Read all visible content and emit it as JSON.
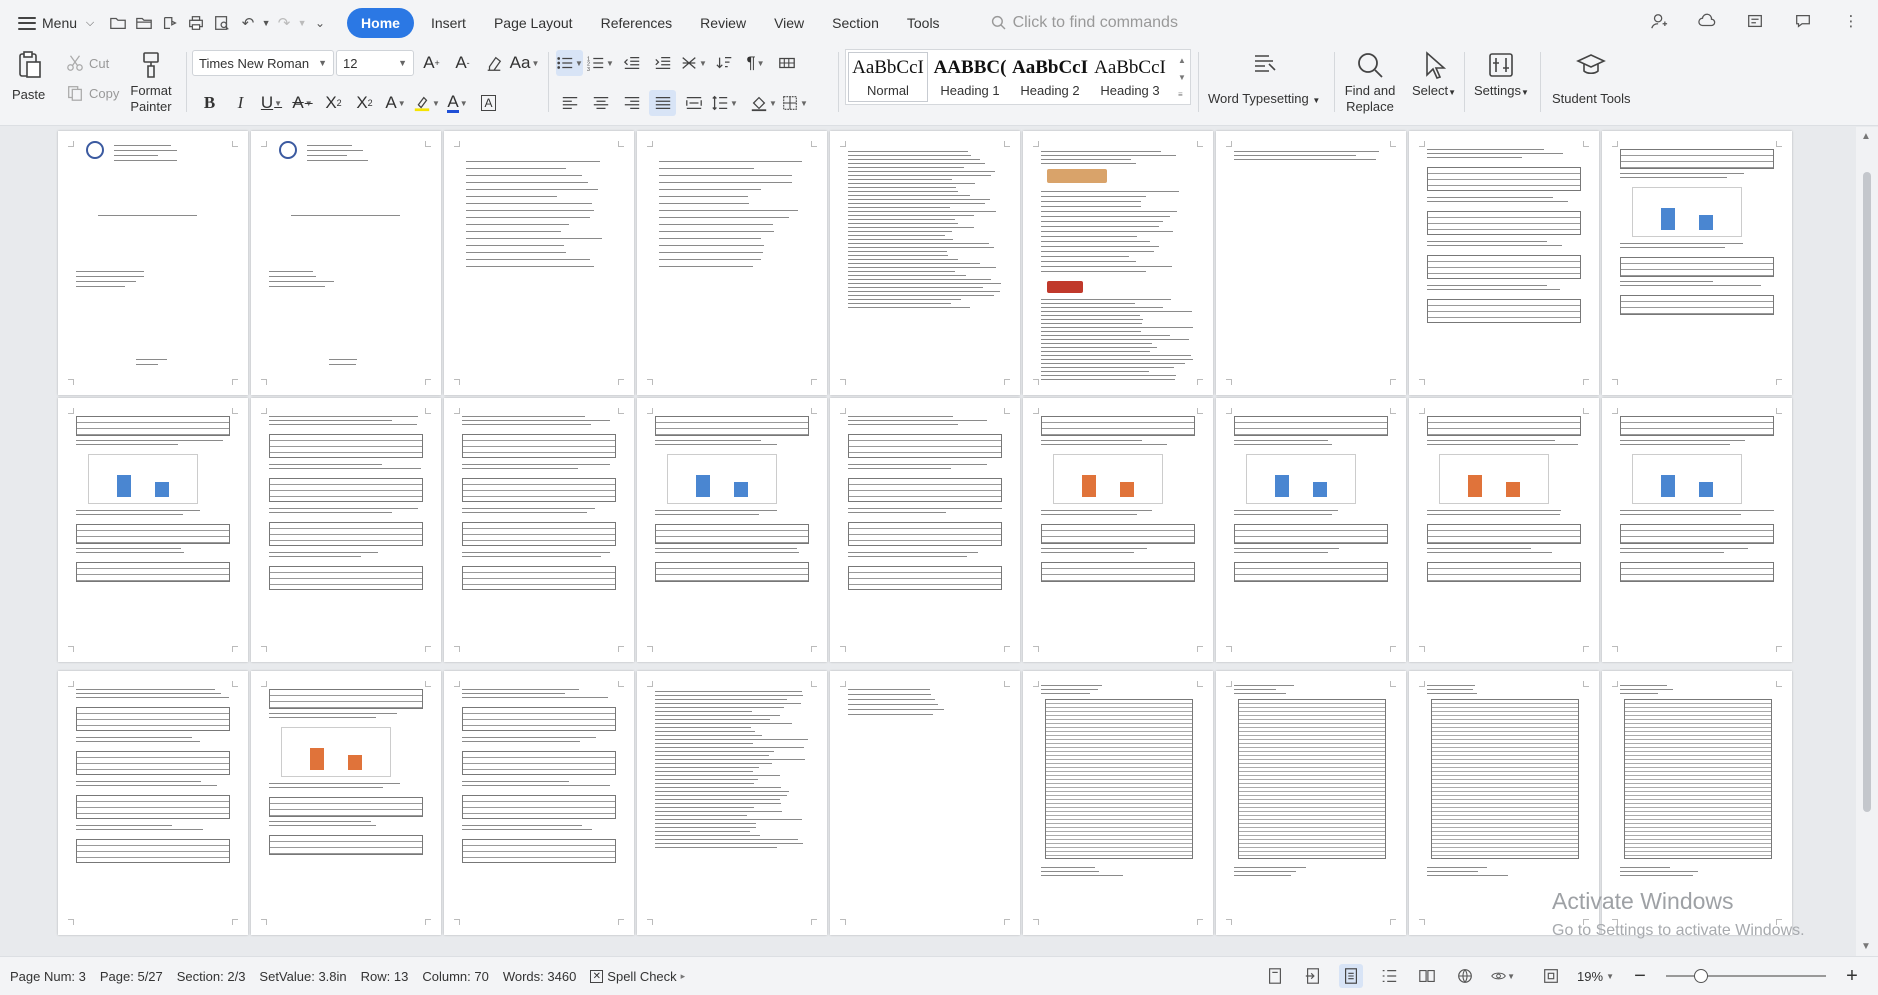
{
  "topbar": {
    "menu_label": "Menu",
    "tabs": [
      {
        "label": "Home",
        "active": true
      },
      {
        "label": "Insert"
      },
      {
        "label": "Page Layout"
      },
      {
        "label": "References"
      },
      {
        "label": "Review"
      },
      {
        "label": "View"
      },
      {
        "label": "Section"
      },
      {
        "label": "Tools"
      }
    ],
    "search_placeholder": "Click to find commands"
  },
  "ribbon": {
    "paste_label": "Paste",
    "cut_label": "Cut",
    "copy_label": "Copy",
    "format_painter_label": "Format Painter",
    "font_name": "Times New Roman",
    "font_size": "12",
    "styles": [
      {
        "preview": "AaBbCcI",
        "name": "Normal",
        "selected": true
      },
      {
        "preview": "AABBC(",
        "name": "Heading 1"
      },
      {
        "preview": "AaBbCcI",
        "name": "Heading 2"
      },
      {
        "preview": "AaBbCcI",
        "name": "Heading 3"
      }
    ],
    "word_typesetting_label": "Word Typesetting",
    "find_replace_label": "Find and Replace",
    "select_label": "Select",
    "settings_label": "Settings",
    "student_tools_label": "Student Tools",
    "accent_color": "#2b78e4",
    "font_color": "#1f4fd6",
    "highlight_color": "#f5e400"
  },
  "watermark": {
    "title": "Activate Windows",
    "subtitle": "Go to Settings to activate Windows."
  },
  "statusbar": {
    "page_num": "Page Num: 3",
    "page": "Page: 5/27",
    "section": "Section: 2/3",
    "set_value": "SetValue: 3.8in",
    "row": "Row: 13",
    "column": "Column: 70",
    "words": "Words: 3460",
    "spell_check": "Spell Check",
    "zoom": "19%",
    "zoom_fraction": 0.19
  }
}
